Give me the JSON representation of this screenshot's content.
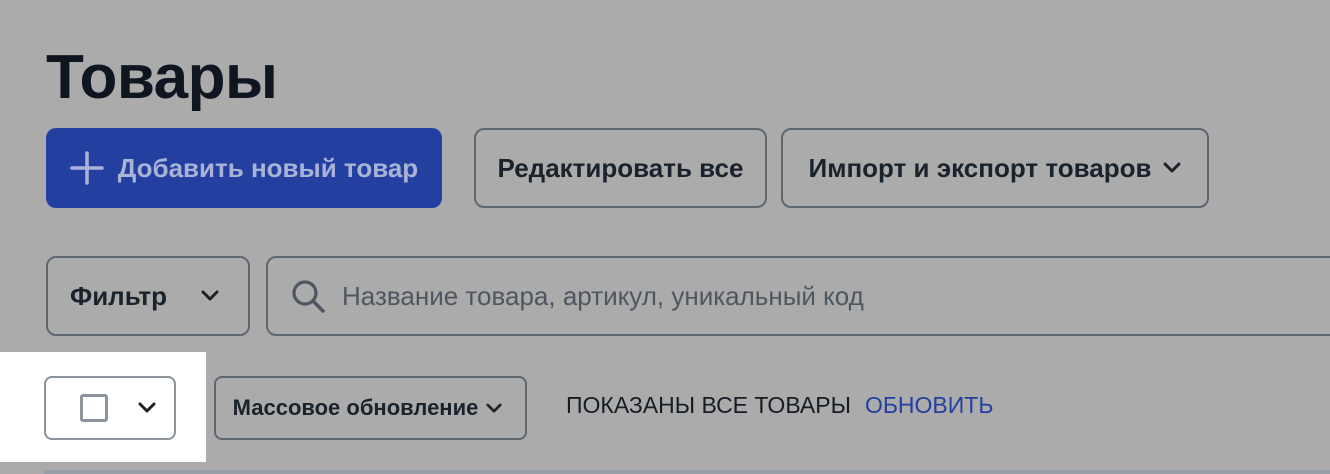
{
  "page": {
    "title": "Товары"
  },
  "toolbar": {
    "add_label": "Добавить новый товар",
    "edit_all_label": "Редактировать все",
    "import_export_label": "Импорт и экспорт товаров"
  },
  "filters": {
    "filter_label": "Фильтр",
    "search_placeholder": "Название товара, артикул, уникальный код",
    "search_value": ""
  },
  "bulk": {
    "mass_update_label": "Массовое обновление",
    "status_text": "ПОКАЗАНЫ ВСЕ ТОВАРЫ",
    "refresh_label": "ОБНОВИТЬ"
  },
  "colors": {
    "primary": "#233fa0",
    "background": "#ababab",
    "highlight": "#ffffff"
  },
  "icons": {
    "add": "plus-icon",
    "dropdown": "chevron-down-icon",
    "search": "search-icon",
    "select_all": "checkbox-icon"
  }
}
